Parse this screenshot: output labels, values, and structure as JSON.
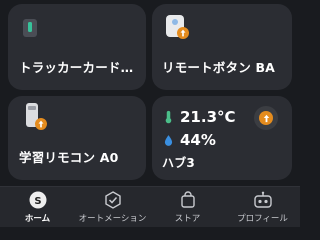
{
  "cards": {
    "tracker": {
      "title": "トラッカーカード…",
      "icon": "tracker-icon"
    },
    "remote_button": {
      "title": "リモートボタン BA",
      "icon": "remote-button-icon"
    },
    "learning_remote": {
      "title": "学習リモコン A0",
      "icon": "learning-remote-icon"
    },
    "hub": {
      "title": "ハブ3",
      "temperature": "21.3°C",
      "humidity": "44%"
    }
  },
  "nav": {
    "items": [
      {
        "label": "ホーム",
        "icon": "home-icon",
        "active": true
      },
      {
        "label": "オートメーション",
        "icon": "automation-icon",
        "active": false
      },
      {
        "label": "ストア",
        "icon": "store-icon",
        "active": false
      },
      {
        "label": "プロフィール",
        "icon": "profile-icon",
        "active": false
      }
    ]
  },
  "colors": {
    "background": "#191b1f",
    "card": "#2b2d33",
    "accent_orange": "#e58c1e",
    "temp_green": "#4bbf8a",
    "humidity_blue": "#3a8fe0"
  }
}
